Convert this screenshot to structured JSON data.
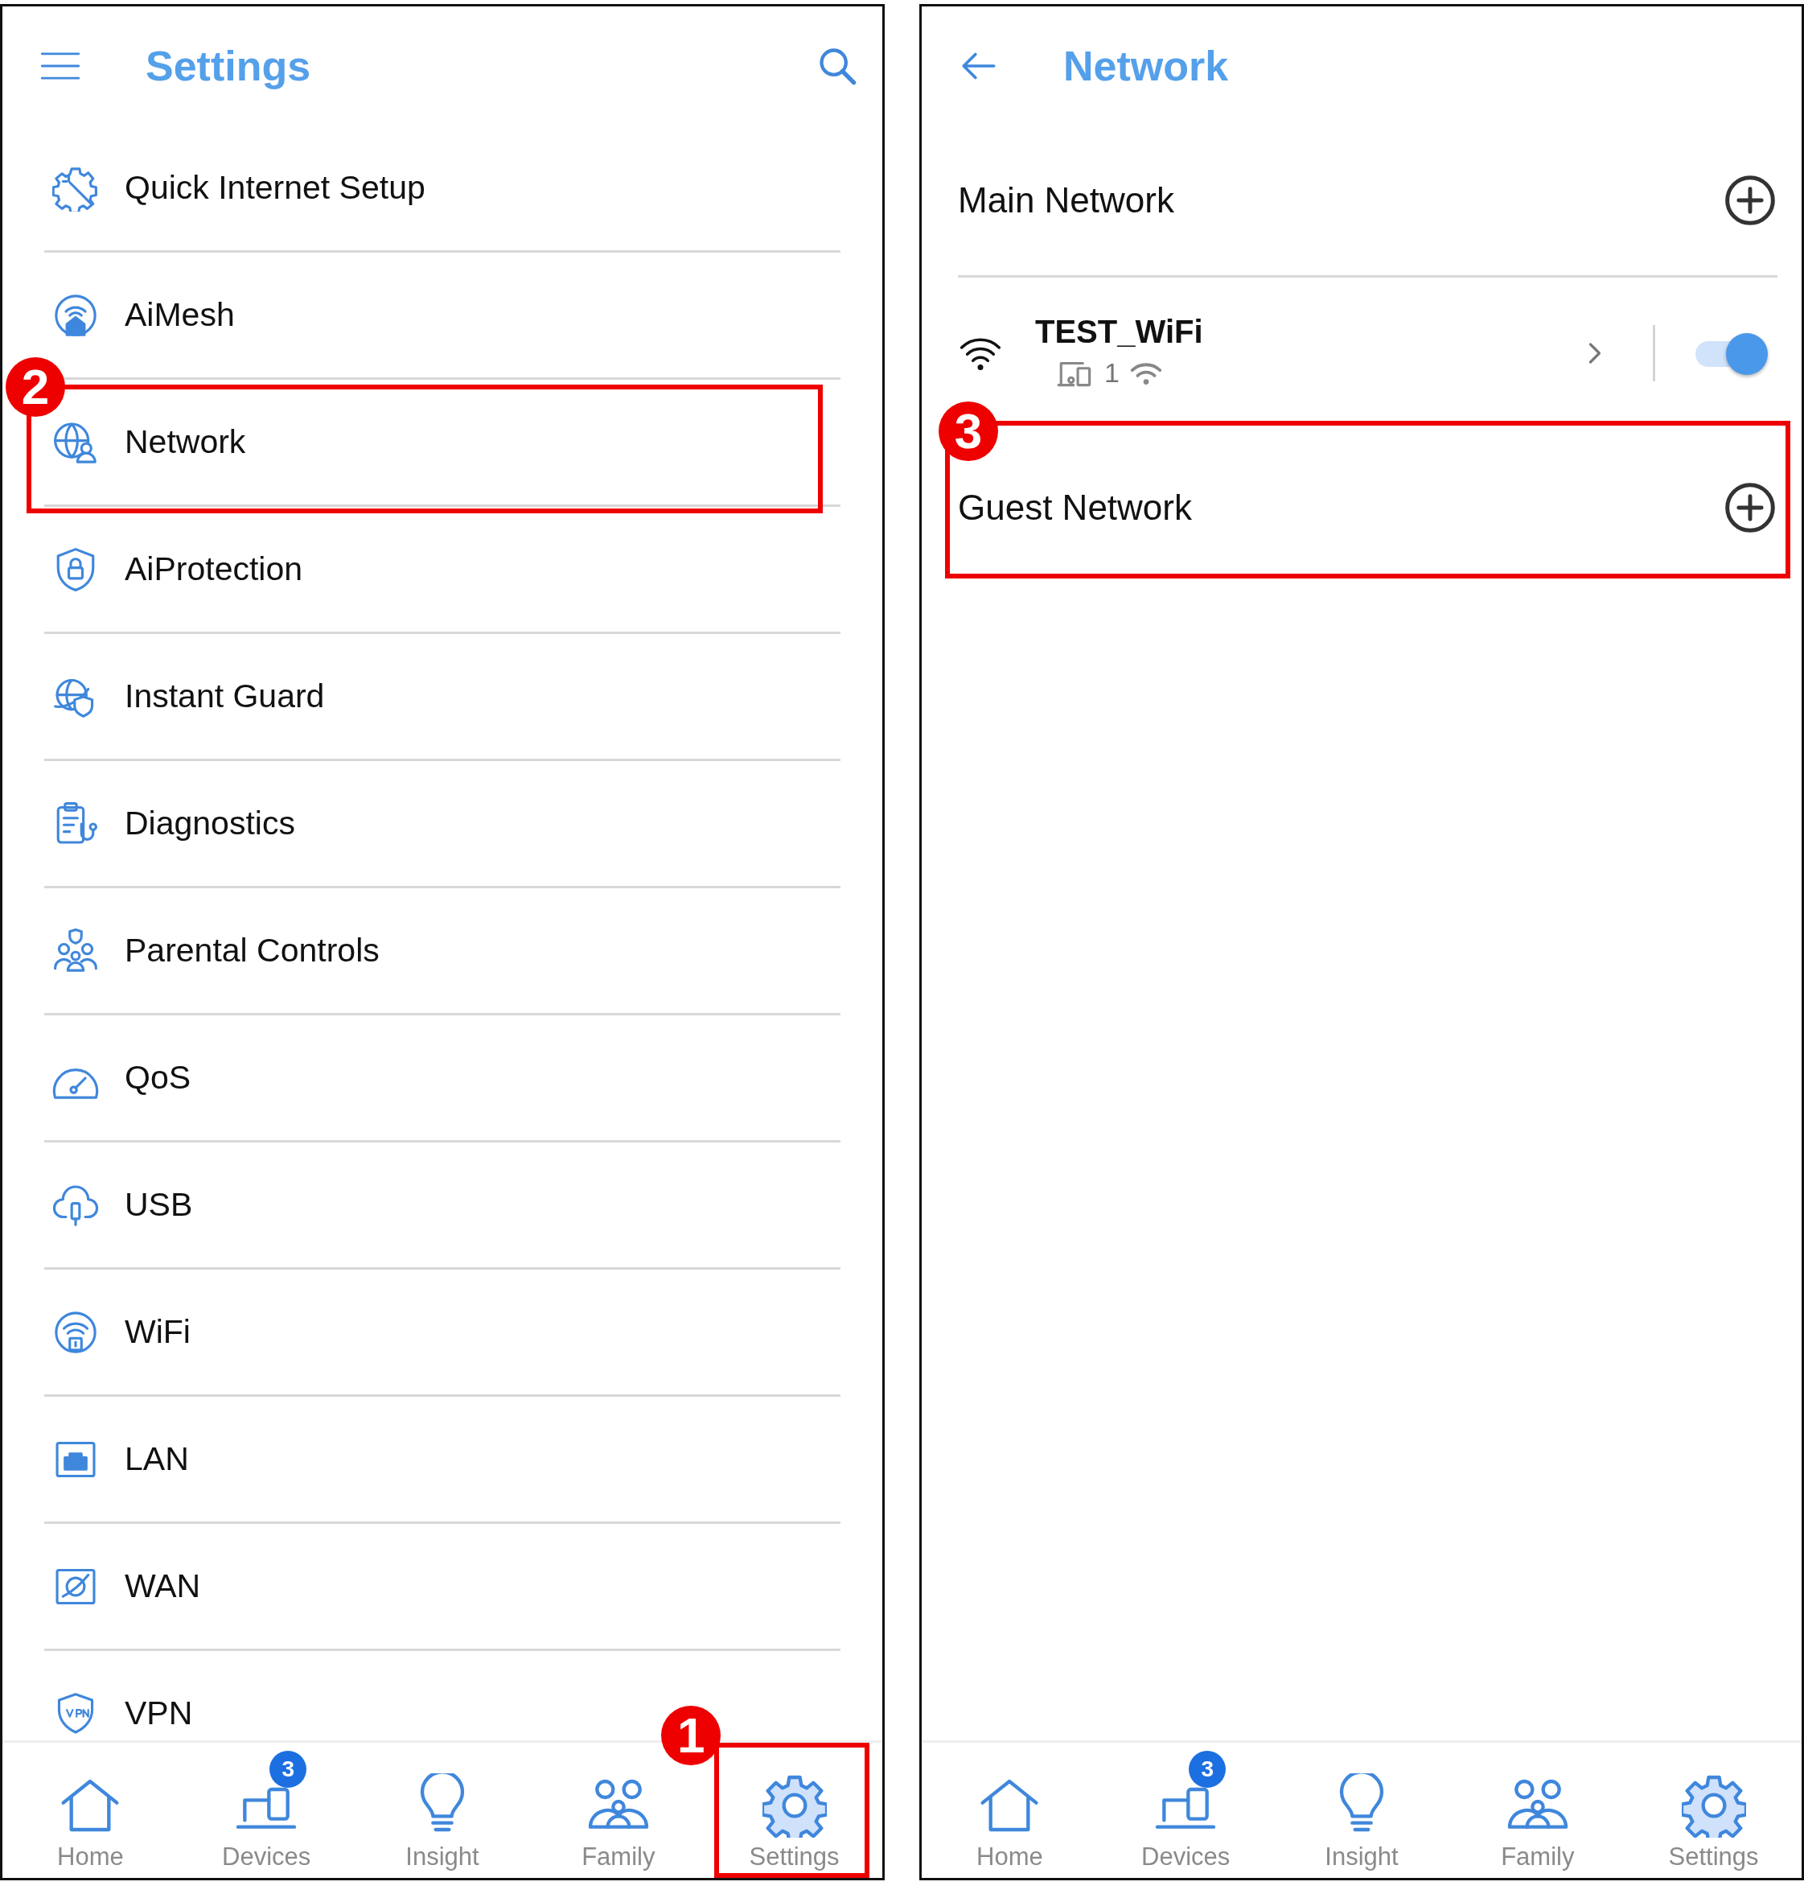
{
  "settings_screen": {
    "title": "Settings",
    "items": [
      {
        "label": "Quick Internet Setup"
      },
      {
        "label": "AiMesh"
      },
      {
        "label": "Network",
        "annotation": "2"
      },
      {
        "label": "AiProtection"
      },
      {
        "label": "Instant Guard"
      },
      {
        "label": "Diagnostics"
      },
      {
        "label": "Parental Controls"
      },
      {
        "label": "QoS"
      },
      {
        "label": "USB"
      },
      {
        "label": "WiFi"
      },
      {
        "label": "LAN"
      },
      {
        "label": "WAN"
      },
      {
        "label": "VPN"
      }
    ],
    "bottom_nav": [
      {
        "label": "Home",
        "selected": false
      },
      {
        "label": "Devices",
        "badge": "3",
        "selected": false
      },
      {
        "label": "Insight",
        "selected": false
      },
      {
        "label": "Family",
        "selected": false
      },
      {
        "label": "Settings",
        "selected": true,
        "annotation": "1"
      }
    ]
  },
  "network_screen": {
    "title": "Network",
    "sections": [
      {
        "title": "Main Network",
        "networks": [
          {
            "name": "TEST_WiFi",
            "client_count": "1",
            "on": true
          }
        ]
      },
      {
        "title": "Guest Network",
        "annotation": "3"
      }
    ],
    "bottom_nav": [
      {
        "label": "Home",
        "selected": false
      },
      {
        "label": "Devices",
        "badge": "3",
        "selected": false
      },
      {
        "label": "Insight",
        "selected": false
      },
      {
        "label": "Family",
        "selected": false
      },
      {
        "label": "Settings",
        "selected": true
      }
    ]
  }
}
